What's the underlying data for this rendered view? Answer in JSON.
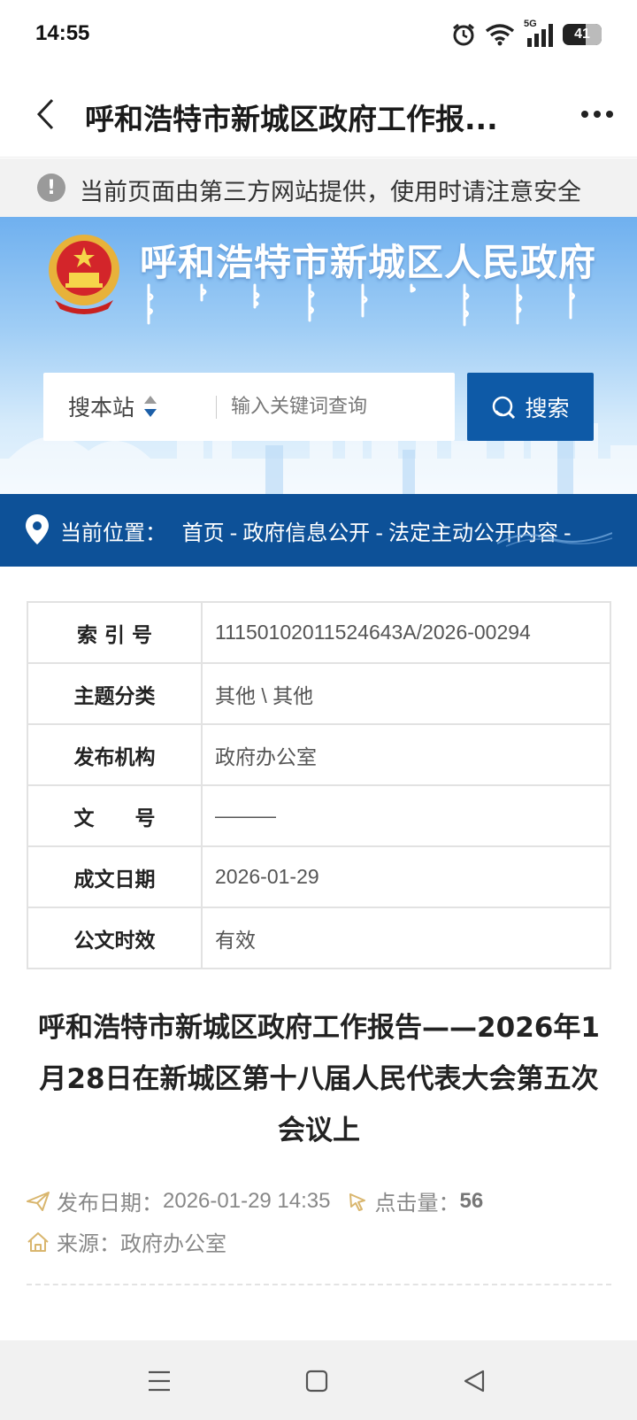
{
  "status_bar": {
    "time": "14:55",
    "network": "5G",
    "battery": "41"
  },
  "header": {
    "title": "呼和浩特市新城区政府工作报..."
  },
  "warning": {
    "text": "当前页面由第三方网站提供，使用时请注意安全"
  },
  "banner": {
    "gov_name": "呼和浩特市新城区人民政府",
    "search_scope": "搜本站",
    "search_placeholder": "输入关键词查询",
    "search_button": "搜索"
  },
  "breadcrumb": {
    "label": "当前位置：",
    "items": [
      "首页",
      "政府信息公开",
      "法定主动公开内容"
    ],
    "sep": "-"
  },
  "info_table": [
    {
      "label": "索 引 号",
      "value": "11150102011524643A/2026-00294"
    },
    {
      "label": "主题分类",
      "value": "其他 \\ 其他"
    },
    {
      "label": "发布机构",
      "value": "政府办公室"
    },
    {
      "label": "文　　号",
      "value": "———"
    },
    {
      "label": "成文日期",
      "value": "2026-01-29"
    },
    {
      "label": "公文时效",
      "value": "有效"
    }
  ],
  "article": {
    "title": "呼和浩特市新城区政府工作报告——2026年1月28日在新城区第十八届人民代表大会第五次会议上",
    "publish_label": "发布日期：",
    "publish_date": "2026-01-29 14:35",
    "views_label": "点击量：",
    "views": "56",
    "source_label": "来源：",
    "source": "政府办公室"
  },
  "colors": {
    "accent": "#0d5198",
    "search_button": "#0e5aa7",
    "meta_icon": "#d9b66e"
  }
}
